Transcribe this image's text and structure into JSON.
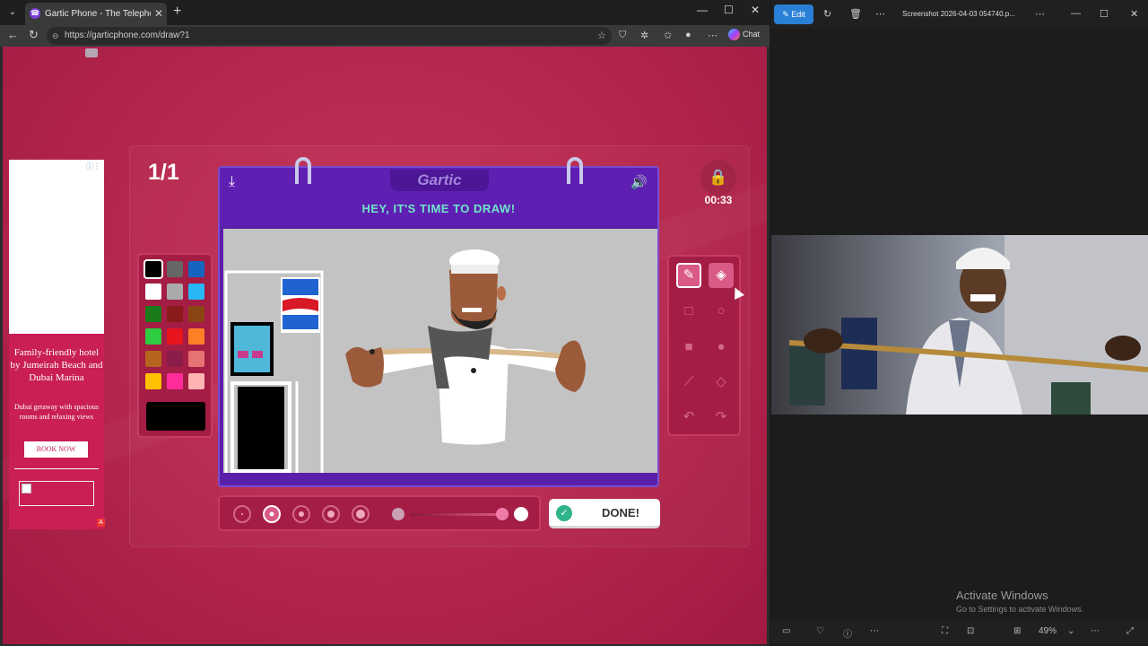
{
  "browser": {
    "tab_title": "Gartic Phone - The Telephone Gar",
    "tab_icon": "gartic-favicon",
    "url": "https://garticphone.com/draw?1",
    "chat_label": "Chat"
  },
  "ad": {
    "headline": "Family-friendly hotel by Jumeirah Beach and Dubai Marina",
    "subtext": "Dubai getaway with spacious rooms and relaxing views",
    "cta": "BOOK NOW"
  },
  "game": {
    "round": "1/1",
    "timer": "00:33",
    "logo": "Gartic",
    "title": "HEY, IT'S TIME TO DRAW!",
    "done_label": "DONE!",
    "selected_color": "#000000",
    "palette": [
      "#000000",
      "#666666",
      "#1565c0",
      "#ffffff",
      "#aaaaaa",
      "#29b6f6",
      "#1b7a1b",
      "#8b1a1a",
      "#8b4513",
      "#2ecc40",
      "#e8141e",
      "#ff7f27",
      "#b5651d",
      "#8c1d4a",
      "#e57373",
      "#ffc000",
      "#ff2d9a",
      "#ffb3b3"
    ],
    "brush_sizes": 5,
    "selected_brush_size": 2,
    "opacity": 1
  },
  "viewer": {
    "edit_label": "Edit",
    "file_title": "Screenshot 2026-04-03 054740.p...",
    "zoom": "49%",
    "activate_title": "Activate Windows",
    "activate_sub": "Go to Settings to activate Windows."
  }
}
